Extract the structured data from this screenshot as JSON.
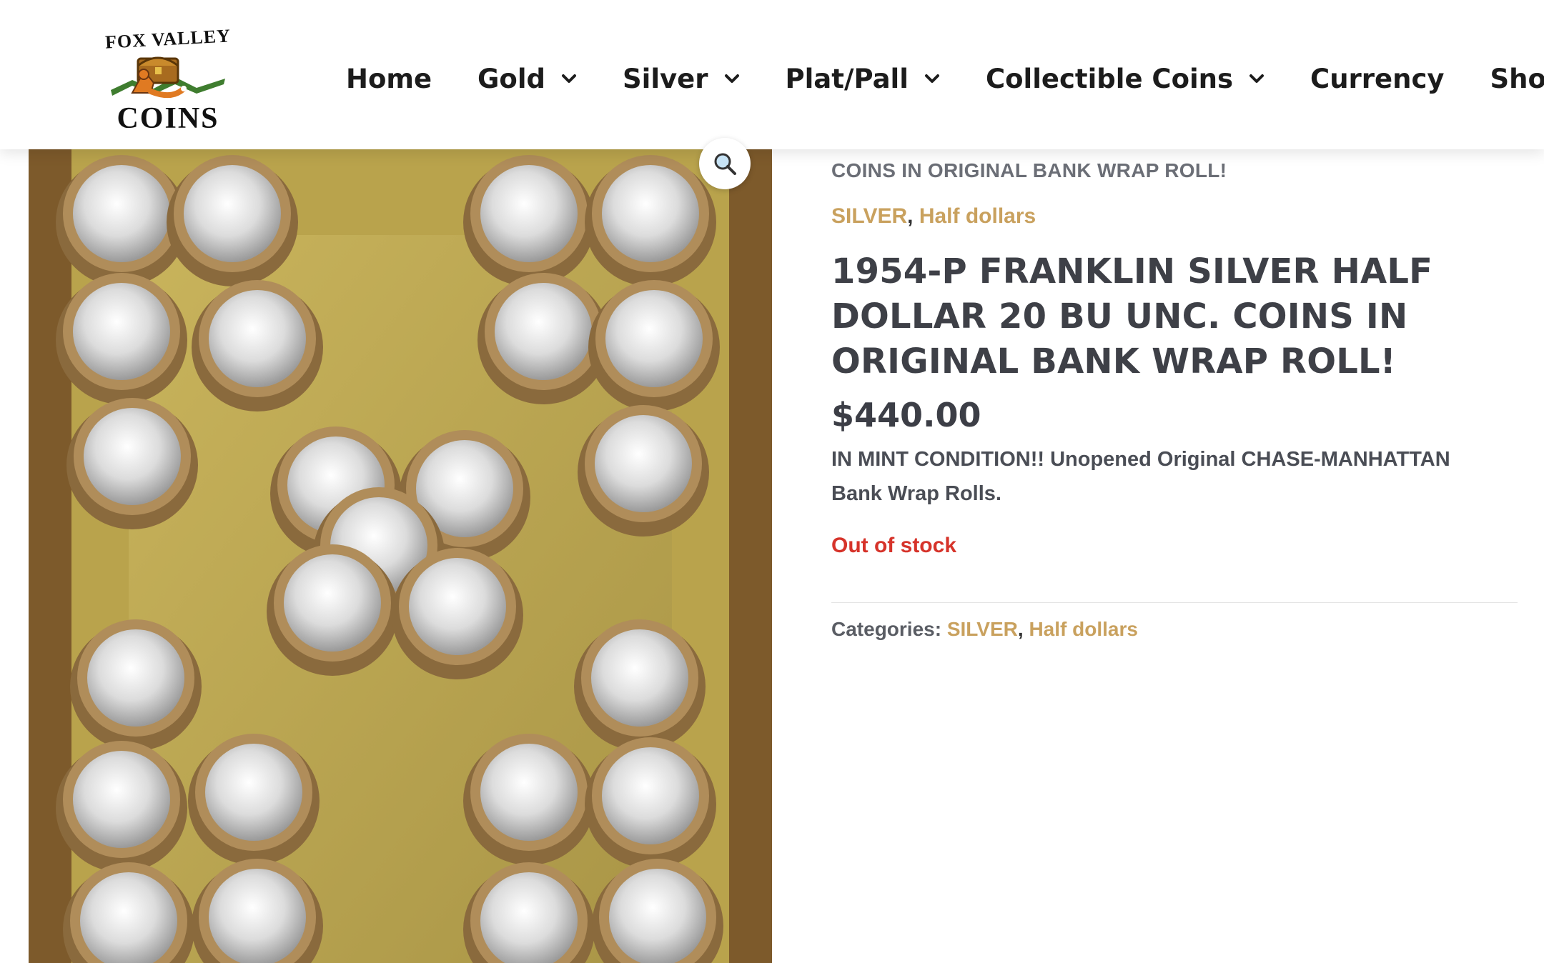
{
  "logo": {
    "top_text": "FOX VALLEY",
    "bottom_text": "COINS"
  },
  "nav": {
    "items": [
      {
        "label": "Home",
        "has_dropdown": false
      },
      {
        "label": "Gold",
        "has_dropdown": true
      },
      {
        "label": "Silver",
        "has_dropdown": true
      },
      {
        "label": "Plat/Pall",
        "has_dropdown": true
      },
      {
        "label": "Collectible Coins",
        "has_dropdown": true
      },
      {
        "label": "Currency",
        "has_dropdown": false
      },
      {
        "label": "Shop",
        "has_dropdown": false
      }
    ]
  },
  "product": {
    "breadcrumb": "COINS IN ORIGINAL BANK WRAP ROLL!",
    "categories": [
      "SILVER",
      "Half dollars"
    ],
    "separator": ",",
    "title": "1954-P FRANKLIN SILVER HALF DOLLAR 20 BU UNC. COINS IN ORIGINAL BANK WRAP ROLL!",
    "price": "$440.00",
    "description": "IN MINT CONDITION!! Unopened Original CHASE-MANHATTAN Bank Wrap Rolls.",
    "stock_status": "Out of stock",
    "meta_label": "Categories:",
    "zoom_icon": "magnifier-icon"
  },
  "colors": {
    "link_gold": "#c9a15e",
    "stock_red": "#d6332a",
    "title_gray": "#3e4047"
  }
}
